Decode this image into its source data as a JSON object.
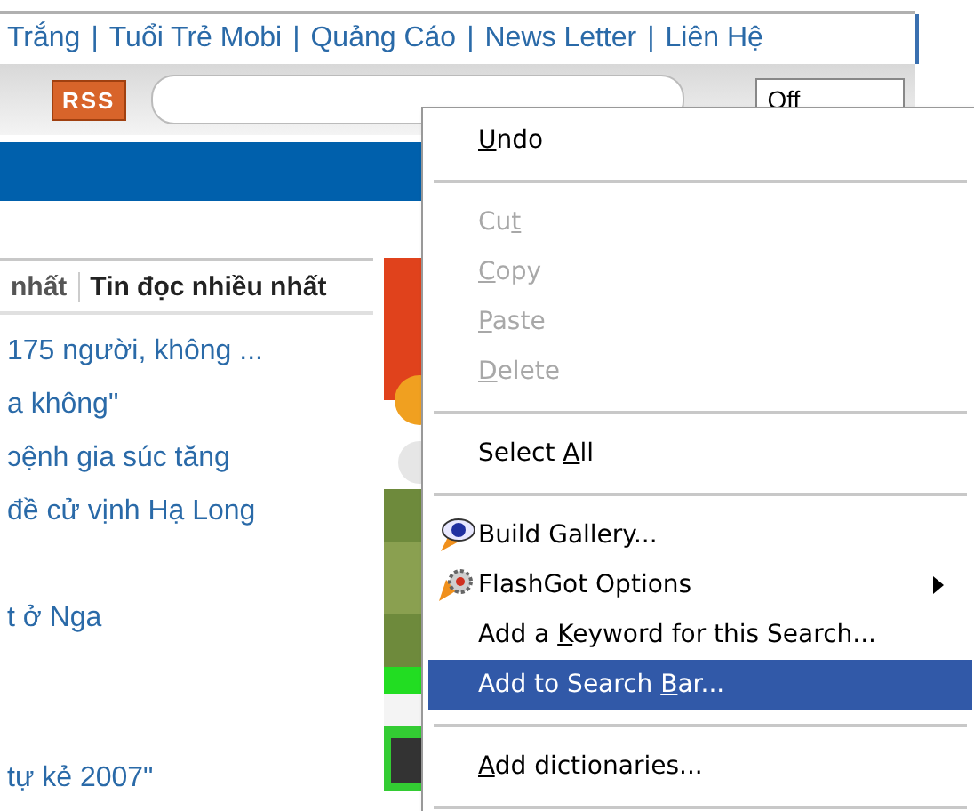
{
  "top_links": [
    {
      "text": "Trắng"
    },
    {
      "separator": "|",
      "text": "Tuổi Trẻ Mobi"
    },
    {
      "separator": "|",
      "text": "Quảng Cáo"
    },
    {
      "separator": "|",
      "text": "News Letter"
    },
    {
      "separator": "|",
      "text": "Liên Hệ"
    }
  ],
  "toolbar": {
    "rss_label": "RSS",
    "select_value": "Off"
  },
  "tabs": [
    {
      "label": "nhất",
      "selected": false
    },
    {
      "label": "Tin đọc nhiều nhất",
      "selected": true
    }
  ],
  "news": [
    {
      "kind": "link",
      "text": "175 người, không ..."
    },
    {
      "kind": "link",
      "text": "a không\""
    },
    {
      "kind": "link",
      "text": "ɔệnh gia súc tăng"
    },
    {
      "kind": "link",
      "text": "đề cử vịnh Hạ Long"
    },
    {
      "kind": "spacer"
    },
    {
      "kind": "link",
      "text": "t ở Nga"
    },
    {
      "kind": "spacer"
    },
    {
      "kind": "spacer"
    },
    {
      "kind": "link",
      "text": "tự kẻ 2007\""
    }
  ],
  "context_menu": [
    {
      "kind": "item",
      "key": "U",
      "post": "ndo",
      "disabled": false,
      "selected": false
    },
    {
      "kind": "separator"
    },
    {
      "kind": "item",
      "pre": "Cu",
      "key": "t",
      "disabled": true,
      "selected": false
    },
    {
      "kind": "item",
      "key": "C",
      "post": "opy",
      "disabled": true,
      "selected": false
    },
    {
      "kind": "item",
      "key": "P",
      "post": "aste",
      "disabled": true,
      "selected": false
    },
    {
      "kind": "item",
      "key": "D",
      "post": "elete",
      "disabled": true,
      "selected": false
    },
    {
      "kind": "separator"
    },
    {
      "kind": "item",
      "pre": "Select ",
      "key": "A",
      "post": "ll",
      "disabled": false,
      "selected": false
    },
    {
      "kind": "separator"
    },
    {
      "kind": "gallery",
      "pre": "Build Gallery...",
      "disabled": false,
      "selected": false
    },
    {
      "kind": "flashgot",
      "pre": "FlashGot Options",
      "disabled": false,
      "selected": false,
      "submenu": true
    },
    {
      "kind": "item",
      "pre": "Add a ",
      "key": "K",
      "post": "eyword for this Search...",
      "disabled": false,
      "selected": false
    },
    {
      "kind": "item",
      "pre": "Add to Search ",
      "key": "B",
      "post": "ar...",
      "disabled": false,
      "selected": true
    },
    {
      "kind": "separator"
    },
    {
      "kind": "item",
      "key": "A",
      "post": "dd dictionaries...",
      "disabled": false,
      "selected": false
    },
    {
      "kind": "separator"
    }
  ]
}
